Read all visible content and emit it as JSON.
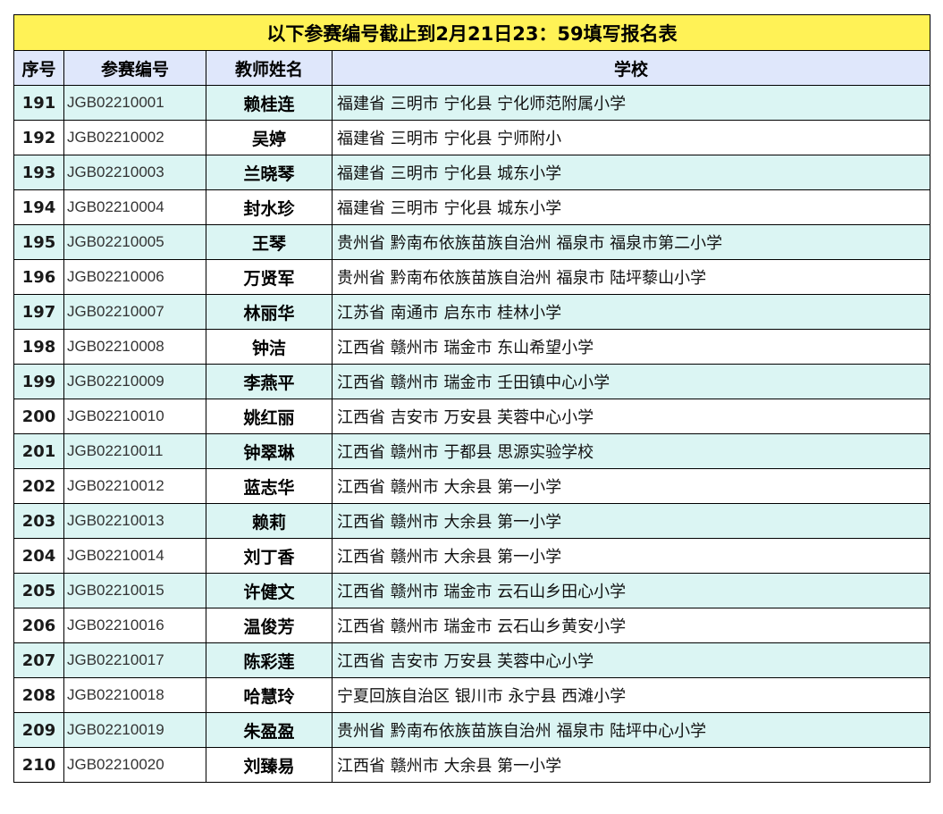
{
  "title": "以下参赛编号截止到2月21日23：59填写报名表",
  "headers": {
    "seq": "序号",
    "code": "参赛编号",
    "teacher": "教师姓名",
    "school": "学校"
  },
  "colors": {
    "title_bg": "#fff256",
    "header_bg": "#dfe7fb",
    "alt_row_bg": "#dbf5f3"
  },
  "rows": [
    {
      "seq": "191",
      "code": "JGB02210001",
      "teacher": "赖桂连",
      "school": "福建省 三明市 宁化县 宁化师范附属小学"
    },
    {
      "seq": "192",
      "code": "JGB02210002",
      "teacher": "吴婷",
      "school": "福建省 三明市 宁化县 宁师附小"
    },
    {
      "seq": "193",
      "code": "JGB02210003",
      "teacher": "兰晓琴",
      "school": "福建省 三明市 宁化县 城东小学"
    },
    {
      "seq": "194",
      "code": "JGB02210004",
      "teacher": "封水珍",
      "school": "福建省 三明市 宁化县 城东小学"
    },
    {
      "seq": "195",
      "code": "JGB02210005",
      "teacher": "王琴",
      "school": "贵州省 黔南布依族苗族自治州 福泉市 福泉市第二小学"
    },
    {
      "seq": "196",
      "code": "JGB02210006",
      "teacher": "万贤军",
      "school": "贵州省 黔南布依族苗族自治州 福泉市 陆坪藜山小学"
    },
    {
      "seq": "197",
      "code": "JGB02210007",
      "teacher": "林丽华",
      "school": "江苏省 南通市 启东市 桂林小学"
    },
    {
      "seq": "198",
      "code": "JGB02210008",
      "teacher": "钟洁",
      "school": "江西省 赣州市 瑞金市 东山希望小学"
    },
    {
      "seq": "199",
      "code": "JGB02210009",
      "teacher": "李燕平",
      "school": "江西省 赣州市 瑞金市 壬田镇中心小学"
    },
    {
      "seq": "200",
      "code": "JGB02210010",
      "teacher": "姚红丽",
      "school": "江西省 吉安市 万安县 芙蓉中心小学"
    },
    {
      "seq": "201",
      "code": "JGB02210011",
      "teacher": "钟翠琳",
      "school": "江西省 赣州市 于都县 思源实验学校"
    },
    {
      "seq": "202",
      "code": "JGB02210012",
      "teacher": "蓝志华",
      "school": "江西省 赣州市 大余县 第一小学"
    },
    {
      "seq": "203",
      "code": "JGB02210013",
      "teacher": "赖莉",
      "school": "江西省 赣州市 大余县 第一小学"
    },
    {
      "seq": "204",
      "code": "JGB02210014",
      "teacher": "刘丁香",
      "school": "江西省 赣州市 大余县 第一小学"
    },
    {
      "seq": "205",
      "code": "JGB02210015",
      "teacher": "许健文",
      "school": "江西省 赣州市 瑞金市 云石山乡田心小学"
    },
    {
      "seq": "206",
      "code": "JGB02210016",
      "teacher": "温俊芳",
      "school": "江西省 赣州市 瑞金市 云石山乡黄安小学"
    },
    {
      "seq": "207",
      "code": "JGB02210017",
      "teacher": "陈彩莲",
      "school": "江西省 吉安市 万安县 芙蓉中心小学"
    },
    {
      "seq": "208",
      "code": "JGB02210018",
      "teacher": "哈慧玲",
      "school": "宁夏回族自治区 银川市 永宁县 西滩小学"
    },
    {
      "seq": "209",
      "code": "JGB02210019",
      "teacher": "朱盈盈",
      "school": "贵州省 黔南布依族苗族自治州 福泉市 陆坪中心小学"
    },
    {
      "seq": "210",
      "code": "JGB02210020",
      "teacher": "刘臻易",
      "school": "江西省 赣州市 大余县 第一小学"
    }
  ]
}
